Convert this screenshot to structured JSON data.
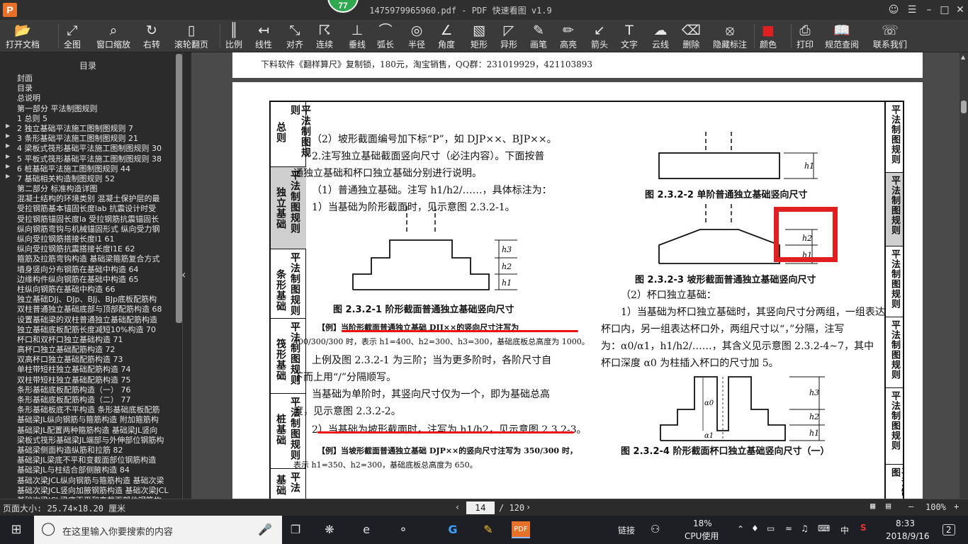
{
  "window": {
    "title": "1475979965960.pdf - PDF 快速看图 v1.9",
    "badge": "77",
    "logo": "P"
  },
  "toolbar": [
    {
      "label": "打开文档",
      "icon": "folder-icon"
    },
    {
      "label": "全图",
      "icon": "fit-all-icon"
    },
    {
      "label": "窗口缩放",
      "icon": "zoom-window-icon"
    },
    {
      "label": "右转",
      "icon": "rotate-right-icon"
    },
    {
      "label": "滚轮翻页",
      "icon": "mouse-wheel-icon"
    },
    {
      "label": "比例",
      "icon": "ruler-scale-icon"
    },
    {
      "label": "线性",
      "icon": "linear-measure-icon"
    },
    {
      "label": "对齐",
      "icon": "aligned-measure-icon"
    },
    {
      "label": "连续",
      "icon": "continuous-measure-icon"
    },
    {
      "label": "垂线",
      "icon": "perpendicular-icon"
    },
    {
      "label": "弧长",
      "icon": "arc-length-icon"
    },
    {
      "label": "半径",
      "icon": "radius-icon"
    },
    {
      "label": "角度",
      "icon": "angle-icon"
    },
    {
      "label": "矩形",
      "icon": "rectangle-icon"
    },
    {
      "label": "异形",
      "icon": "polygon-icon"
    },
    {
      "label": "画笔",
      "icon": "brush-icon"
    },
    {
      "label": "高亮",
      "icon": "highlight-icon"
    },
    {
      "label": "箭头",
      "icon": "arrow-icon"
    },
    {
      "label": "文字",
      "icon": "text-icon"
    },
    {
      "label": "云线",
      "icon": "cloud-line-icon"
    },
    {
      "label": "删除",
      "icon": "eraser-icon"
    },
    {
      "label": "隐藏标注",
      "icon": "hide-markup-icon"
    },
    {
      "label": "颜色",
      "icon": "color-swatch-icon"
    },
    {
      "label": "打印",
      "icon": "printer-icon"
    },
    {
      "label": "规范查阅",
      "icon": "book-icon"
    },
    {
      "label": "联系我们",
      "icon": "contact-icon"
    }
  ],
  "sidebar": {
    "title": "目录",
    "items": [
      {
        "text": "封面",
        "arrow": false
      },
      {
        "text": "目录",
        "arrow": false
      },
      {
        "text": "总说明",
        "arrow": false
      },
      {
        "text": "第一部分 平法制图规则",
        "arrow": false
      },
      {
        "text": "1 总则 5",
        "arrow": false
      },
      {
        "text": "2 独立基础平法施工图制图规则 7",
        "arrow": true
      },
      {
        "text": "3 条形基础平法施工图制图规则 21",
        "arrow": true
      },
      {
        "text": "4 梁板式筏形基础平法施工图制图规则 30",
        "arrow": true
      },
      {
        "text": "5 平板式筏形基础平法施工图制图规则 38",
        "arrow": true
      },
      {
        "text": "6 桩基础平法施工图制图规则 44",
        "arrow": true
      },
      {
        "text": "7 基础相关构造制图规则 52",
        "arrow": true
      },
      {
        "text": "第二部分 标准构造详图",
        "arrow": false
      },
      {
        "text": "混凝土结构的环境类别 混凝土保护层的最",
        "arrow": false
      },
      {
        "text": "受拉钢筋基本锚固长度lab 抗震设计时受",
        "arrow": false
      },
      {
        "text": "受拉钢筋锚固长度la 受拉钢筋抗震锚固长",
        "arrow": false
      },
      {
        "text": "纵向钢筋弯钩与机械锚固形式 纵向受力钢",
        "arrow": false
      },
      {
        "text": "纵向受拉钢筋搭接长度l1 61",
        "arrow": false
      },
      {
        "text": "纵向受拉钢筋抗震搭接长度l1E 62",
        "arrow": false
      },
      {
        "text": "箍筋及拉筋弯钩构造 基础梁箍筋复合方式",
        "arrow": false
      },
      {
        "text": "墙身竖向分布钢筋在基础中构造 64",
        "arrow": false
      },
      {
        "text": "边缘构件纵向钢筋在基础中构造 65",
        "arrow": false
      },
      {
        "text": "柱纵向钢筋在基础中构造 66",
        "arrow": false
      },
      {
        "text": "独立基础DJj、DJp、BJj、BJp底板配筋构",
        "arrow": false
      },
      {
        "text": "双柱普通独立基础底部与顶部配筋构造 68",
        "arrow": false
      },
      {
        "text": "设置基础梁的双柱普通独立基础配筋构造",
        "arrow": false
      },
      {
        "text": "独立基础底板配筋长度减短10%构造 70",
        "arrow": false
      },
      {
        "text": "杯口和双杯口独立基础构造 71",
        "arrow": false
      },
      {
        "text": "高杯口独立基础配筋构造 72",
        "arrow": false
      },
      {
        "text": "双高杯口独立基础配筋构造 73",
        "arrow": false
      },
      {
        "text": "单柱带短柱独立基础配筋构造 74",
        "arrow": false
      },
      {
        "text": "双柱带短柱独立基础配筋构造 75",
        "arrow": false
      },
      {
        "text": "条形基础底板配筋构造（一） 76",
        "arrow": false
      },
      {
        "text": "条形基础底板配筋构造（二） 77",
        "arrow": false
      },
      {
        "text": "条形基础板底不平构造 条形基础底板配筋",
        "arrow": false
      },
      {
        "text": "基础梁JL纵向钢筋与箍筋构造 附加箍筋构",
        "arrow": false
      },
      {
        "text": "基础梁JL配置两种箍筋构造 基础梁JL竖向",
        "arrow": false
      },
      {
        "text": "梁板式筏形基础梁JL端部与外伸部位钢筋构",
        "arrow": false
      },
      {
        "text": "基础梁侧面构造纵筋和拉筋 82",
        "arrow": false
      },
      {
        "text": "基础梁JL梁底不平和变截面部位钢筋构造",
        "arrow": false
      },
      {
        "text": "基础梁JL与柱结合部侧腋构造 84",
        "arrow": false
      },
      {
        "text": "基础次梁JCL纵向钢筋与箍筋构造 基础次梁",
        "arrow": false
      },
      {
        "text": "基础次梁JCL竖向加腋钢筋构造 基础次梁JCL",
        "arrow": false
      },
      {
        "text": "基础次梁JCL梁底不平和变截面部位钢筋构",
        "arrow": false
      }
    ]
  },
  "document": {
    "header_text": "下料软件《翻样算尺》复制锁，180元，淘宝销售，QQ群：231019929，421103893",
    "left_tabs": [
      {
        "a": "总则",
        "b": "平法制图规则",
        "active": false
      },
      {
        "a": "独立基础",
        "b": "平法制图规则",
        "active": true
      },
      {
        "a": "条形基础",
        "b": "平法制图规则",
        "active": false
      },
      {
        "a": "筏形基础",
        "b": "平法制图规则",
        "active": false
      },
      {
        "a": "桩基础",
        "b": "平法制图规则",
        "active": false
      },
      {
        "a": "基础",
        "b": "平法",
        "active": false
      }
    ],
    "right_tabs": [
      {
        "text": "平法制图规则",
        "active": false
      },
      {
        "text": "平法制图规则",
        "active": true
      },
      {
        "text": "平法制图规则",
        "active": false
      },
      {
        "text": "平法制图规则",
        "active": false
      },
      {
        "text": "平法制图规则",
        "active": false
      },
      {
        "text": "平法制图",
        "active": false
      }
    ],
    "left_col": [
      "（2）坡形截面编号加下标“P”，如 DJP××、BJP××。",
      "2.注写独立基础截面竖向尺寸（必注内容）。下面按普",
      "通独立基础和杯口独立基础分别进行说明。",
      "（1）普通独立基础。注写 h1/h2/……，具体标注为：",
      "1）当基础为阶形截面时，见示意图 2.3.2-1。"
    ],
    "fig1_caption": "图 2.3.2-1 阶形截面普通独立基础竖向尺寸",
    "example1_line1": "【例】当阶形截面普通独立基础 DJJ××的竖向尺寸注写为",
    "example1_line2": "400/300/300 时，表示 h1=400、h2=300、h3=300，基础底板总高度为 1000。",
    "left_col2": [
      "上例及图 2.3.2-1 为三阶；当为更多阶时，各阶尺寸自",
      "下而上用“/”分隔顺写。",
      "当基础为单阶时，其竖向尺寸仅为一个，即为基础总高",
      "度，见示意图 2.3.2-2。",
      "2）当基础为坡形截面时，注写为 h1/h2，见示意图 2.3.2-3。"
    ],
    "example2_line1": "【例】当坡形截面普通独立基础 DJP××的竖向尺寸注写为 350/300 时，",
    "example2_line2": "表示 h1=350、h2=300，基础底板总高度为 650。",
    "fig2_caption": "图 2.3.2-2 单阶普通独立基础竖向尺寸",
    "fig3_caption": "图 2.3.2-3 坡形截面普通独立基础竖向尺寸",
    "right_col": [
      "（2）杯口独立基础：",
      "1）当基础为杯口独立基础时，其竖向尺寸分两组，一组表达",
      "杯口内，另一组表达杯口外，两组尺寸以“，”分隔，注写",
      "为：α0/α1，h1/h2/……，其含义见示意图 2.3.2-4~7，其中",
      "杯口深度 α0 为柱插入杯口的尺寸加 5。"
    ],
    "fig4_caption": "图 2.3.2-4 阶形截面杯口独立基础竖向尺寸（一）",
    "dim_labels": {
      "h1": "h1",
      "h2": "h2",
      "h3": "h3",
      "a0": "α0",
      "a1": "α1"
    }
  },
  "status": {
    "page_size": "页面大小: 25.74×18.20 厘米",
    "current_page": "14",
    "total_pages": "/ 120",
    "zoom": "100%"
  },
  "taskbar": {
    "search_placeholder": "在这里输入你要搜索的内容",
    "link_label": "链接",
    "cpu_percent": "18%",
    "cpu_label": "CPU使用",
    "ime": "中",
    "time": "8:33",
    "date": "2018/9/16",
    "notifications": "2"
  },
  "colors": {
    "accent_red": "#e02020",
    "badge_green": "#2fa84f",
    "logo_orange": "#e8712a"
  }
}
